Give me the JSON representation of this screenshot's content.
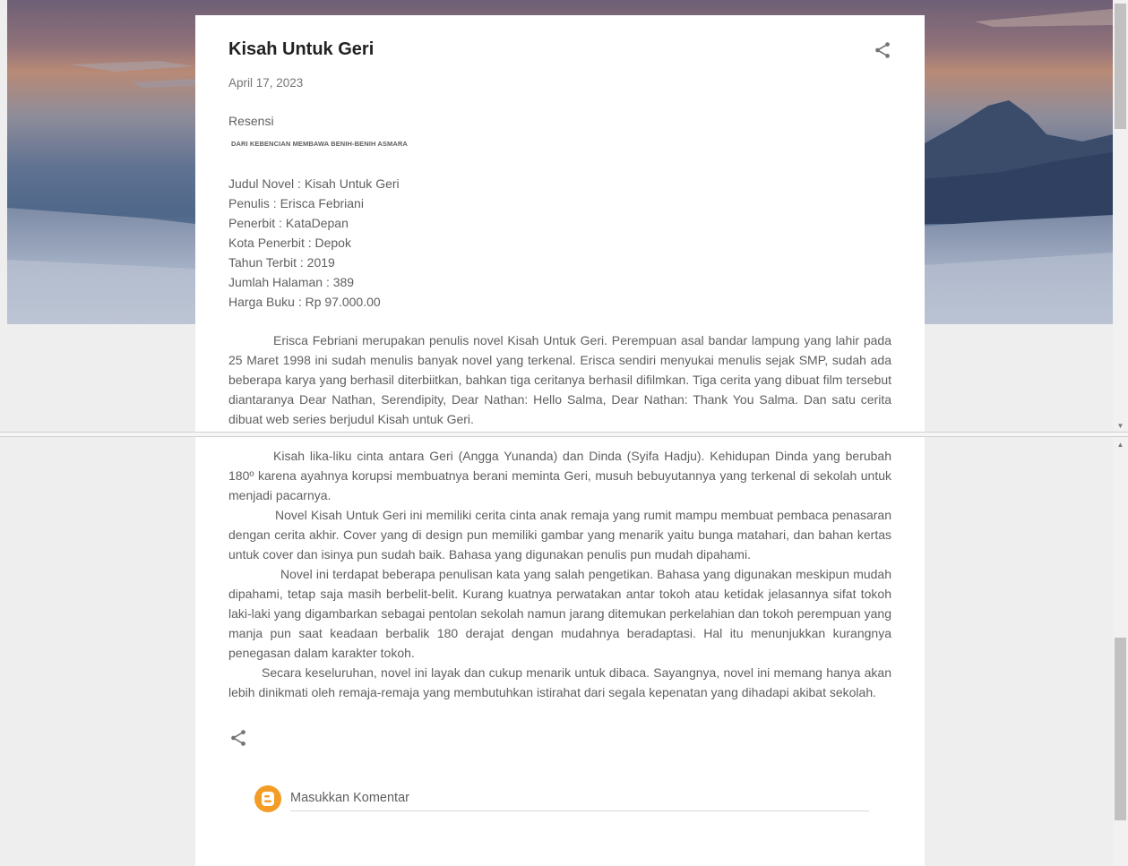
{
  "post": {
    "title": "Kisah Untuk Geri",
    "date": "April 17, 2023",
    "label": "Resensi",
    "subheading": "DARI KEBENCIAN MEMBAWA BENIH-BENIH ASMARA",
    "details": [
      "Judul Novel : Kisah Untuk Geri",
      "Penulis : Erisca Febriani",
      "Penerbit : KataDepan",
      "Kota Penerbit : Depok",
      "Tahun Terbit : 2019",
      "Jumlah Halaman : 389",
      "Harga Buku : Rp 97.000.00"
    ],
    "paragraph_top": "Erisca Febriani merupakan penulis novel Kisah Untuk Geri. Perempuan asal bandar lampung yang lahir pada 25 Maret 1998 ini sudah menulis banyak novel yang terkenal. Erisca sendiri menyukai menulis sejak SMP, sudah ada beberapa karya yang berhasil diterbiitkan, bahkan tiga ceritanya berhasil difilmkan. Tiga cerita yang dibuat film tersebut diantaranya Dear Nathan, Serendipity, Dear Nathan: Hello Salma, Dear Nathan: Thank You Salma. Dan satu cerita dibuat web series berjudul Kisah untuk Geri.",
    "paragraphs_bottom": [
      "Kisah lika-liku cinta antara Geri (Angga Yunanda) dan Dinda (Syifa Hadju). Kehidupan Dinda yang berubah 180º karena ayahnya korupsi membuatnya berani meminta Geri, musuh bebuyutannya yang terkenal di sekolah untuk menjadi pacarnya.",
      "Novel Kisah Untuk Geri ini memiliki cerita cinta anak remaja yang rumit mampu membuat pembaca penasaran dengan cerita akhir. Cover yang di design pun memiliki gambar yang menarik yaitu bunga matahari, dan bahan kertas untuk cover dan isinya pun sudah baik. Bahasa yang digunakan penulis pun mudah dipahami.",
      "Novel ini terdapat beberapa penulisan kata yang salah pengetikan. Bahasa yang digunakan meskipun mudah dipahami, tetap saja masih berbelit-belit. Kurang kuatnya perwatakan antar tokoh atau ketidak jelasannya sifat tokoh laki-laki yang digambarkan sebagai pentolan sekolah namun jarang ditemukan perkelahian dan tokoh perempuan yang manja pun saat keadaan berbalik 180 derajat dengan mudahnya beradaptasi. Hal itu menunjukkan kurangnya penegasan dalam karakter tokoh.",
      "Secara keseluruhan, novel ini layak dan cukup menarik untuk dibaca. Sayangnya, novel ini memang hanya akan lebih dinikmati oleh remaja-remaja yang membutuhkan istirahat dari segala kepenatan yang dihadapi akibat sekolah."
    ]
  },
  "comments": {
    "placeholder": "Masukkan Komentar"
  },
  "icons": {
    "share": "share-icon",
    "blogger": "blogger-icon"
  },
  "colors": {
    "title": "#212121",
    "body_text": "#5f5f5f",
    "blogger_orange": "#f39c26",
    "page_bg": "#eeeeee"
  }
}
